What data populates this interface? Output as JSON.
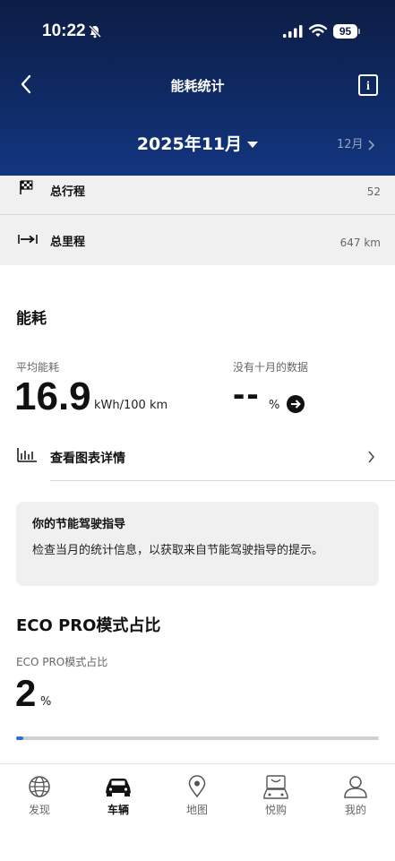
{
  "status_bar": {
    "time": "10:22",
    "battery": "95"
  },
  "header": {
    "title": "能耗统计",
    "month": "2025年11月",
    "next_month": "12月"
  },
  "summary": {
    "trips_label": "总行程",
    "trips_value": "52",
    "mileage_label": "总里程",
    "mileage_value": "647 km"
  },
  "energy": {
    "title": "能耗",
    "avg_label": "平均能耗",
    "avg_value": "16.9",
    "avg_unit": "kWh/100 km",
    "compare_label": "没有十月的数据",
    "compare_value": "--",
    "compare_unit": "%"
  },
  "chart_link": {
    "label": "查看图表详情"
  },
  "guide": {
    "title": "你的节能驾驶指导",
    "text": "检查当月的统计信息，以获取来自节能驾驶指导的提示。"
  },
  "eco": {
    "title": "ECO PRO模式占比",
    "label": "ECO PRO模式占比",
    "value": "2",
    "unit": "%",
    "progress_fraction": 0.02
  },
  "tabs": [
    {
      "label": "发现",
      "icon": "globe-icon"
    },
    {
      "label": "车辆",
      "icon": "car-icon"
    },
    {
      "label": "地图",
      "icon": "map-pin-icon"
    },
    {
      "label": "悦购",
      "icon": "shop-icon"
    },
    {
      "label": "我的",
      "icon": "profile-icon"
    }
  ],
  "colors": {
    "header_dark": "#0d1c44",
    "header_light": "#133680",
    "progress": "#2f6fd8"
  }
}
